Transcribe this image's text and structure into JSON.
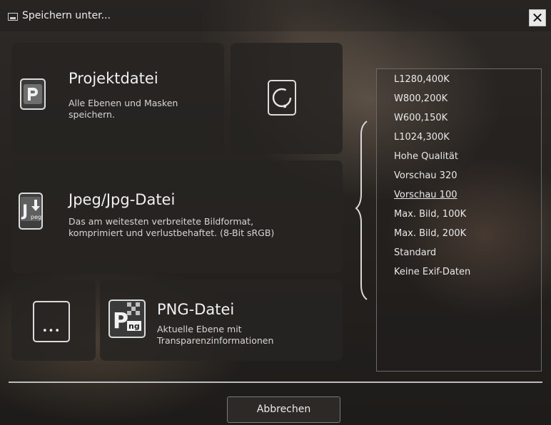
{
  "window": {
    "title": "Speichern unter...",
    "close_glyph": "✕"
  },
  "options": {
    "project": {
      "title": "Projektdatei",
      "description": "Alle Ebenen und Masken\n speichern.",
      "icon": "project-file-icon",
      "icon_letter": "P"
    },
    "jpeg": {
      "title": "Jpeg/Jpg-Datei",
      "description": "Das am weitesten verbreitete Bildformat,\n komprimiert und verlustbehaftet. (8-Bit sRGB)",
      "icon": "jpeg-file-icon",
      "icon_letter": "J",
      "icon_sub": "peg"
    },
    "png": {
      "title": "PNG-Datei",
      "description": "Aktuelle Ebene mit\n Transparenzinformationen",
      "icon": "png-file-icon",
      "icon_letter": "P",
      "icon_sub": "ng"
    },
    "more": {
      "icon": "more-options-icon",
      "glyph": "•••"
    },
    "refresh": {
      "icon": "refresh-icon"
    }
  },
  "presets": {
    "selected": "Vorschau 100",
    "items": [
      "L1280,400K",
      "W800,200K",
      "W600,150K",
      "L1024,300K",
      "Hohe Qualität",
      "Vorschau 320",
      "Vorschau 100",
      "Max. Bild, 100K",
      "Max. Bild, 200K",
      "Standard",
      "Keine Exif-Daten"
    ]
  },
  "footer": {
    "cancel_label": "Abbrechen"
  },
  "colors": {
    "tile_bg": "#262422",
    "text": "#e8e8e8",
    "divider": "#bcbcbc"
  }
}
